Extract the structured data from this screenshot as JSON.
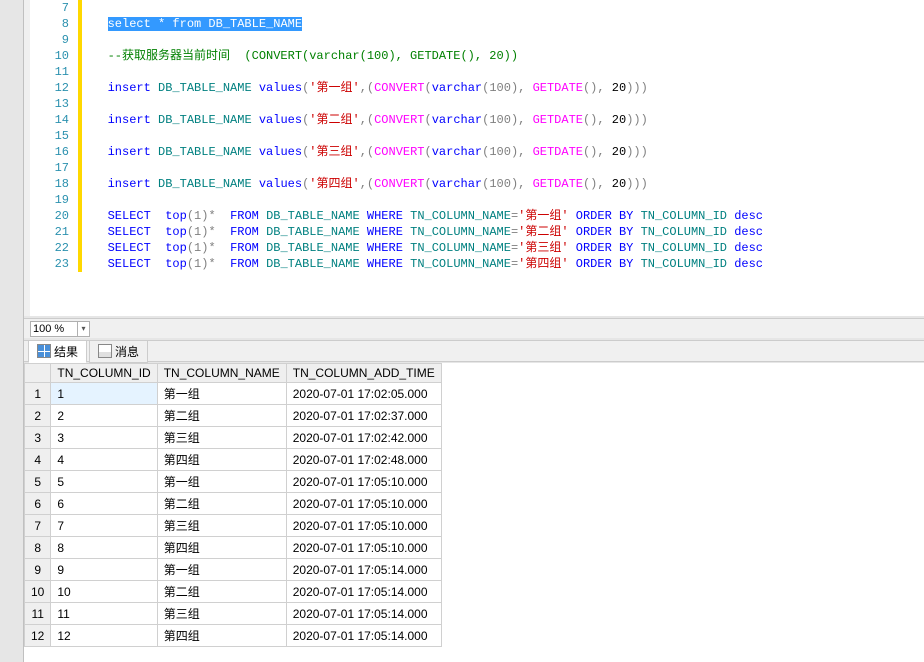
{
  "zoom": {
    "value": "100 %"
  },
  "tabs": {
    "results": "结果",
    "messages": "消息"
  },
  "gutter_start": 7,
  "gutter_end": 23,
  "code": {
    "l8": {
      "sel_pre": "   ",
      "sel_body": "select * from DB_TABLE_NAME"
    },
    "l10_pre": "   ",
    "l10_comment": "--获取服务器当前时间",
    "l10_c2": "  (CONVERT(varchar(100), GETDATE(), 20))",
    "insert_pre": "   ",
    "insert_kw": "insert",
    "table": " DB_TABLE_NAME ",
    "values_kw": "values",
    "lp": "(",
    "comma": ",",
    "rp": ")",
    "rp3": ")))",
    "g1": "'第一组'",
    "g2": "'第二组'",
    "g3": "'第三组'",
    "g4": "'第四组'",
    "conv": "CONVERT",
    "lp2": "(",
    "varchar": "varchar",
    "p100": "(100)",
    "cs": ", ",
    "getdate": "GETDATE",
    "lp3": "()",
    "cs2": ", ",
    "n20": "20",
    "sel_kw": "SELECT",
    "sel_sp": "  ",
    "top": "top",
    "one": "(1)",
    "star": "* ",
    "from_sp": " ",
    "from_kw": "FROM",
    "where_kw": "WHERE",
    "tncol": " TN_COLUMN_NAME",
    "eq": "=",
    "orderby": "ORDER BY",
    "tncolid": " TN_COLUMN_ID ",
    "desc": "desc",
    "sg1": "'第一组'",
    "sg2": "'第二组'",
    "sg3": "'第三组'",
    "sg4": "'第四组'"
  },
  "results": {
    "headers": {
      "id": "TN_COLUMN_ID",
      "name": "TN_COLUMN_NAME",
      "time": "TN_COLUMN_ADD_TIME"
    },
    "rows": [
      {
        "n": "1",
        "id": "1",
        "name": "第一组",
        "time": "2020-07-01 17:02:05.000"
      },
      {
        "n": "2",
        "id": "2",
        "name": "第二组",
        "time": "2020-07-01 17:02:37.000"
      },
      {
        "n": "3",
        "id": "3",
        "name": "第三组",
        "time": "2020-07-01 17:02:42.000"
      },
      {
        "n": "4",
        "id": "4",
        "name": "第四组",
        "time": "2020-07-01 17:02:48.000"
      },
      {
        "n": "5",
        "id": "5",
        "name": "第一组",
        "time": "2020-07-01 17:05:10.000"
      },
      {
        "n": "6",
        "id": "6",
        "name": "第二组",
        "time": "2020-07-01 17:05:10.000"
      },
      {
        "n": "7",
        "id": "7",
        "name": "第三组",
        "time": "2020-07-01 17:05:10.000"
      },
      {
        "n": "8",
        "id": "8",
        "name": "第四组",
        "time": "2020-07-01 17:05:10.000"
      },
      {
        "n": "9",
        "id": "9",
        "name": "第一组",
        "time": "2020-07-01 17:05:14.000"
      },
      {
        "n": "10",
        "id": "10",
        "name": "第二组",
        "time": "2020-07-01 17:05:14.000"
      },
      {
        "n": "11",
        "id": "11",
        "name": "第三组",
        "time": "2020-07-01 17:05:14.000"
      },
      {
        "n": "12",
        "id": "12",
        "name": "第四组",
        "time": "2020-07-01 17:05:14.000"
      }
    ]
  }
}
